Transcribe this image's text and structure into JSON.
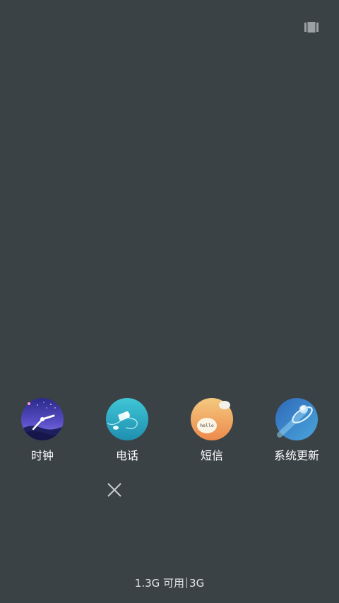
{
  "apps": [
    {
      "label": "时钟",
      "icon": "clock-icon"
    },
    {
      "label": "电话",
      "icon": "phone-icon"
    },
    {
      "label": "短信",
      "icon": "sms-icon"
    },
    {
      "label": "系统更新",
      "icon": "system-update-icon"
    }
  ],
  "sms_icon_text": "hello",
  "memory": {
    "available": "1.3G 可用",
    "total": "3G"
  },
  "colors": {
    "background": "#3b4246"
  }
}
